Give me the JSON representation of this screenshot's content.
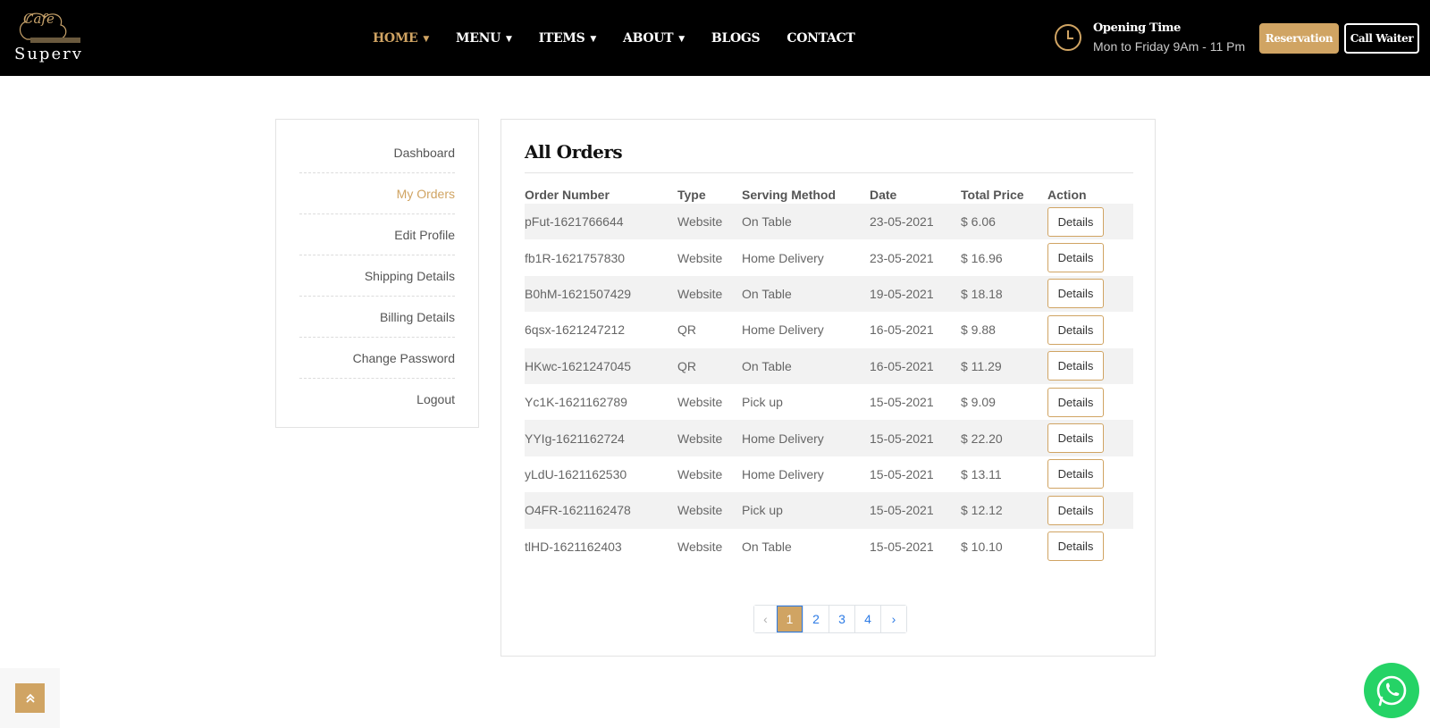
{
  "header": {
    "logo": {
      "cafe": "Cafe",
      "brand": "Superv"
    },
    "nav": [
      {
        "label": "HOME",
        "dropdown": true,
        "active": true
      },
      {
        "label": "MENU",
        "dropdown": true,
        "active": false
      },
      {
        "label": "ITEMS",
        "dropdown": true,
        "active": false
      },
      {
        "label": "ABOUT",
        "dropdown": true,
        "active": false
      },
      {
        "label": "BLOGS",
        "dropdown": false,
        "active": false
      },
      {
        "label": "CONTACT",
        "dropdown": false,
        "active": false
      }
    ],
    "opening_title": "Opening Time",
    "opening_hours": "Mon to Friday 9Am - 11 Pm",
    "reservation_label": "Reservation",
    "call_waiter_label": "Call Waiter"
  },
  "sidebar": {
    "items": [
      {
        "label": "Dashboard",
        "active": false
      },
      {
        "label": "My Orders",
        "active": true
      },
      {
        "label": "Edit Profile",
        "active": false
      },
      {
        "label": "Shipping Details",
        "active": false
      },
      {
        "label": "Billing Details",
        "active": false
      },
      {
        "label": "Change Password",
        "active": false
      },
      {
        "label": "Logout",
        "active": false
      }
    ]
  },
  "orders": {
    "title": "All Orders",
    "columns": [
      "Order Number",
      "Type",
      "Serving Method",
      "Date",
      "Total Price",
      "Action"
    ],
    "details_label": "Details",
    "rows": [
      {
        "number": "pFut-1621766644",
        "type": "Website",
        "method": "On Table",
        "date": "23-05-2021",
        "price": "$ 6.06"
      },
      {
        "number": "fb1R-1621757830",
        "type": "Website",
        "method": "Home Delivery",
        "date": "23-05-2021",
        "price": "$ 16.96"
      },
      {
        "number": "B0hM-1621507429",
        "type": "Website",
        "method": "On Table",
        "date": "19-05-2021",
        "price": "$ 18.18"
      },
      {
        "number": "6qsx-1621247212",
        "type": "QR",
        "method": "Home Delivery",
        "date": "16-05-2021",
        "price": "$ 9.88"
      },
      {
        "number": "HKwc-1621247045",
        "type": "QR",
        "method": "On Table",
        "date": "16-05-2021",
        "price": "$ 11.29"
      },
      {
        "number": "Yc1K-1621162789",
        "type": "Website",
        "method": "Pick up",
        "date": "15-05-2021",
        "price": "$ 9.09"
      },
      {
        "number": "YYIg-1621162724",
        "type": "Website",
        "method": "Home Delivery",
        "date": "15-05-2021",
        "price": "$ 22.20"
      },
      {
        "number": "yLdU-1621162530",
        "type": "Website",
        "method": "Home Delivery",
        "date": "15-05-2021",
        "price": "$ 13.11"
      },
      {
        "number": "O4FR-1621162478",
        "type": "Website",
        "method": "Pick up",
        "date": "15-05-2021",
        "price": "$ 12.12"
      },
      {
        "number": "tlHD-1621162403",
        "type": "Website",
        "method": "On Table",
        "date": "15-05-2021",
        "price": "$ 10.10"
      }
    ]
  },
  "pagination": {
    "prev": "‹",
    "pages": [
      "1",
      "2",
      "3",
      "4"
    ],
    "current": "1",
    "next": "›"
  },
  "floating": {
    "back_to_top_icon": "double-chevron-up-icon",
    "whatsapp_icon": "whatsapp-icon"
  },
  "colors": {
    "accent": "#d0a463",
    "header_bg": "#000000",
    "whatsapp": "#25d366",
    "link": "#2d7be5"
  }
}
